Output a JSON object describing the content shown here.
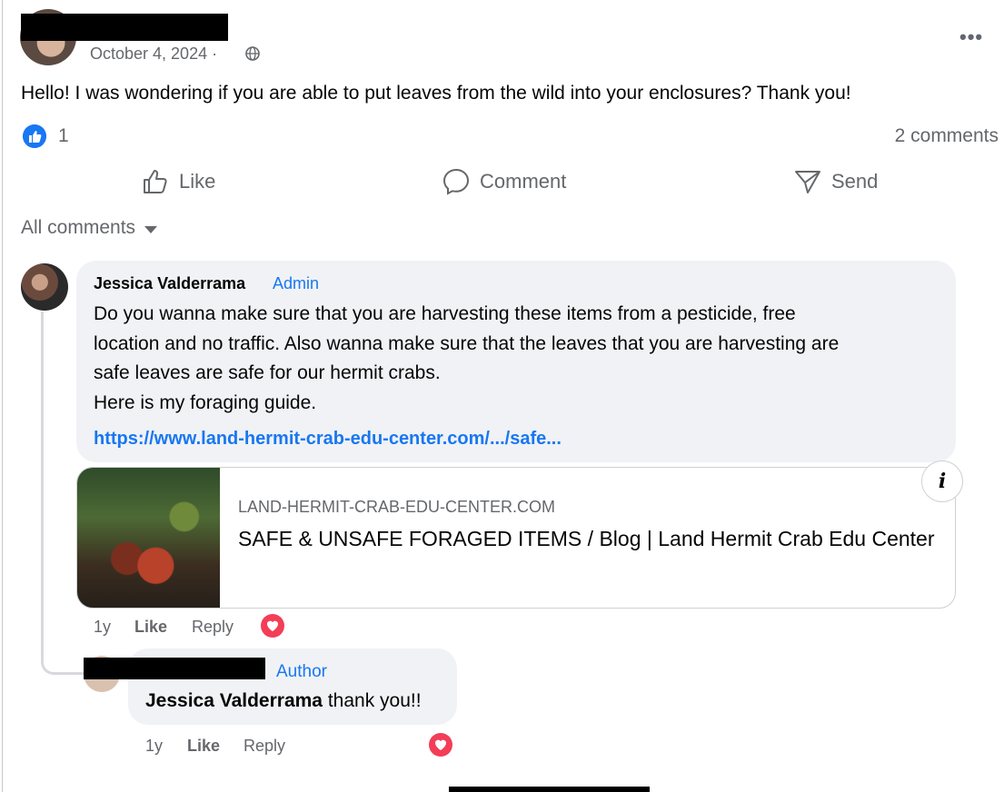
{
  "post": {
    "date": "October 4, 2024 ·",
    "more_label": "•••",
    "text": "Hello! I was wondering if you are able to put leaves from the wild into your enclosures? Thank you!",
    "reaction_count": "1",
    "comments_count": "2 comments"
  },
  "actions": {
    "like": "Like",
    "comment": "Comment",
    "send": "Send"
  },
  "filter": {
    "label": "All comments"
  },
  "comment1": {
    "author": "Jessica Valderrama",
    "badge": "Admin",
    "text": "Do you wanna make sure that you are harvesting these items from a pesticide, free\nlocation and no traffic. Also wanna make sure that the leaves that you are harvesting are\nsafe leaves are safe for our hermit crabs.\nHere is my foraging guide.",
    "link": "https://www.land-hermit-crab-edu-center.com/.../safe...",
    "card": {
      "domain": "LAND-HERMIT-CRAB-EDU-CENTER.COM",
      "title": "SAFE & UNSAFE FORAGED ITEMS / Blog | Land Hermit Crab Edu Center",
      "info": "i"
    },
    "time": "1y",
    "like": "Like",
    "reply": "Reply"
  },
  "reply1": {
    "badge": "Author",
    "mention": "Jessica Valderrama",
    "text": " thank you!!",
    "time": "1y",
    "like": "Like",
    "reply": "Reply"
  },
  "colors": {
    "accent": "#1877f2",
    "heart": "#f33e58",
    "bubble": "#f0f2f5",
    "muted": "#65676b"
  }
}
